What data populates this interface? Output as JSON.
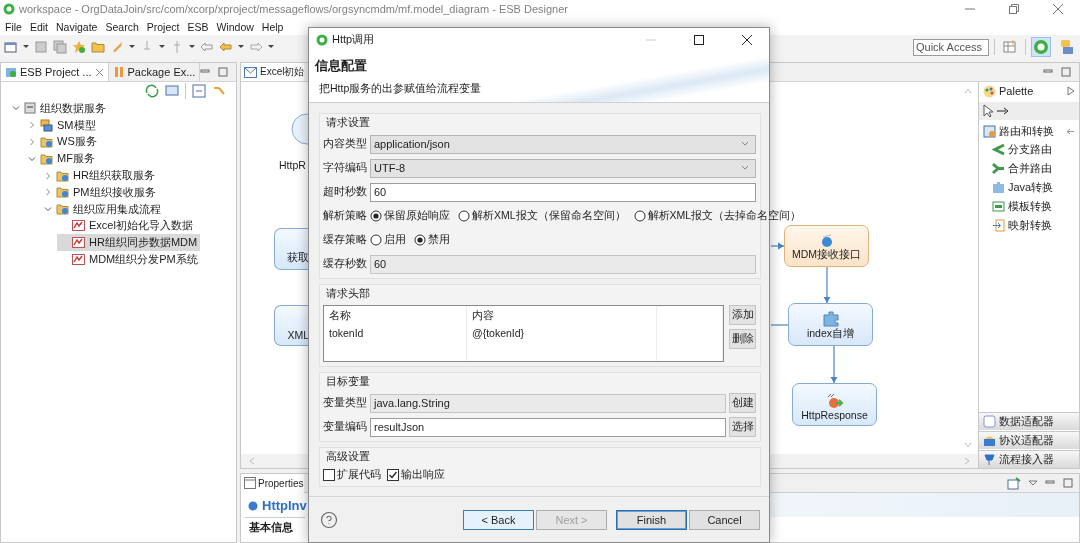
{
  "window": {
    "title": "workspace - OrgDataJoin/src/com/xcorp/xproject/messageflows/orgsyncmdm/mf.model_diagram - ESB Designer"
  },
  "menu": [
    "File",
    "Edit",
    "Navigate",
    "Search",
    "Project",
    "ESB",
    "Window",
    "Help"
  ],
  "toolbar": {
    "quick_access": {
      "placeholder": "Quick Access"
    }
  },
  "explorer": {
    "tabs": [
      {
        "label": "ESB Project ...",
        "selected": true
      },
      {
        "label": "Package Ex...",
        "selected": false
      }
    ],
    "tree": [
      {
        "kind": "root",
        "label": "组织数据服务",
        "expanded": true,
        "children": [
          {
            "kind": "model",
            "label": "SM模型",
            "expanded": false
          },
          {
            "kind": "service",
            "label": "WS服务",
            "expanded": false
          },
          {
            "kind": "service",
            "label": "MF服务",
            "expanded": true,
            "children": [
              {
                "kind": "service",
                "label": "HR组织获取服务",
                "expanded": false
              },
              {
                "kind": "service",
                "label": "PM组织接收服务",
                "expanded": false
              },
              {
                "kind": "service",
                "label": "组织应用集成流程",
                "expanded": true,
                "children": [
                  {
                    "kind": "flow",
                    "label": "Excel初始化导入数据",
                    "selected": false
                  },
                  {
                    "kind": "flow",
                    "label": "HR组织同步数据MDM",
                    "selected": true
                  },
                  {
                    "kind": "flow",
                    "label": "MDM组织分发PM系统",
                    "selected": false
                  }
                ]
              }
            ]
          }
        ]
      }
    ]
  },
  "editor": {
    "tab": "Excel初始",
    "nodes": [
      {
        "kind": "circle",
        "label": "HttpR"
      },
      {
        "kind": "task",
        "label": "获取"
      },
      {
        "kind": "task",
        "label": "XML"
      },
      {
        "kind": "service",
        "label": "MDM接收接口"
      },
      {
        "kind": "task",
        "label": "index自增"
      },
      {
        "kind": "response",
        "label": "HttpResponse"
      }
    ]
  },
  "palette": {
    "title": "Palette",
    "drawers": [
      {
        "label": "路由和转换",
        "expanded": true,
        "items": [
          "分支路由",
          "合并路由",
          "Java转换",
          "模板转换",
          "映射转换"
        ]
      },
      {
        "label": "数据适配器",
        "expanded": false
      },
      {
        "label": "协议适配器",
        "expanded": false
      },
      {
        "label": "流程接入器",
        "expanded": false
      }
    ]
  },
  "properties": {
    "tab": "Properties",
    "title": "HttpInv",
    "tabs": [
      {
        "label": "基本信息",
        "selected": true
      }
    ]
  },
  "dialog": {
    "title": "Http调用",
    "heading": "信息配置",
    "description": "把Http服务的出参赋值给流程变量",
    "groups": [
      {
        "kind": "form",
        "title": "请求设置",
        "rows": [
          {
            "kind": "select",
            "label": "内容类型",
            "value": "application/json"
          },
          {
            "kind": "select",
            "label": "字符编码",
            "value": "UTF-8"
          },
          {
            "kind": "input",
            "label": "超时秒数",
            "value": "60",
            "disabled": false
          },
          {
            "kind": "radios",
            "label": "解析策略",
            "options": [
              {
                "label": "保留原始响应",
                "selected": true
              },
              {
                "label": "解析XML报文（保留命名空间）",
                "selected": false
              },
              {
                "label": "解析XML报文（去掉命名空间）",
                "selected": false
              }
            ]
          },
          {
            "kind": "radios",
            "label": "缓存策略",
            "options": [
              {
                "label": "启用",
                "selected": false
              },
              {
                "label": "禁用",
                "selected": true
              }
            ]
          },
          {
            "kind": "input",
            "label": "缓存秒数",
            "value": "60",
            "disabled": true
          }
        ]
      },
      {
        "kind": "table",
        "title": "请求头部",
        "columns": [
          "名称",
          "内容"
        ],
        "rows": [
          [
            "tokenId",
            "@{tokenId}"
          ]
        ],
        "buttons": [
          "添加",
          "删除"
        ]
      },
      {
        "kind": "form",
        "title": "目标变量",
        "rows": [
          {
            "kind": "input",
            "label": "变量类型",
            "value": "java.lang.String",
            "disabled": true,
            "button": "创建"
          },
          {
            "kind": "input",
            "label": "变量编码",
            "value": "resultJson",
            "disabled": false,
            "button": "选择"
          }
        ]
      },
      {
        "kind": "checks",
        "title": "高级设置",
        "items": [
          {
            "label": "扩展代码",
            "checked": false
          },
          {
            "label": "输出响应",
            "checked": true
          }
        ]
      }
    ],
    "buttons": [
      {
        "label": "< Back",
        "focused": true,
        "default": false,
        "disabled": false
      },
      {
        "label": "Next >",
        "focused": false,
        "default": false,
        "disabled": true
      },
      {
        "label": "Finish",
        "focused": false,
        "default": true,
        "disabled": false
      },
      {
        "label": "Cancel",
        "focused": false,
        "default": false,
        "disabled": false
      }
    ]
  }
}
